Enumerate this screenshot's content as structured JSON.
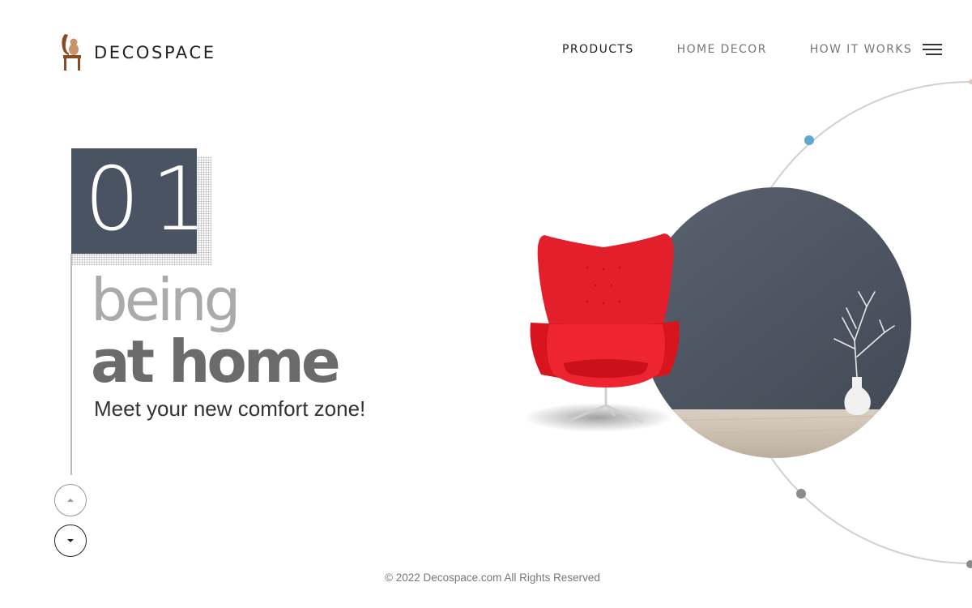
{
  "brand": {
    "name": "DECOSPACE"
  },
  "nav": {
    "items": [
      {
        "label": "PRODUCTS",
        "active": true
      },
      {
        "label": "HOME DECOR",
        "active": false
      },
      {
        "label": "HOW IT WORKS",
        "active": false
      }
    ],
    "menu_icon": "hamburger-icon"
  },
  "hero": {
    "slide_number": "01",
    "headline_light": "being",
    "headline_bold": "at home",
    "tagline": "Meet your new comfort zone!",
    "up_icon": "arrow-up-icon",
    "down_icon": "arrow-down-icon"
  },
  "colors": {
    "accent_dark": "#4a5361",
    "chair_red": "#e41f2c",
    "text_gray": "#6b6b6b",
    "dot_blue": "#5fa7cf"
  },
  "footer": {
    "copyright": "© 2022 Decospace.com All Rights Reserved"
  }
}
